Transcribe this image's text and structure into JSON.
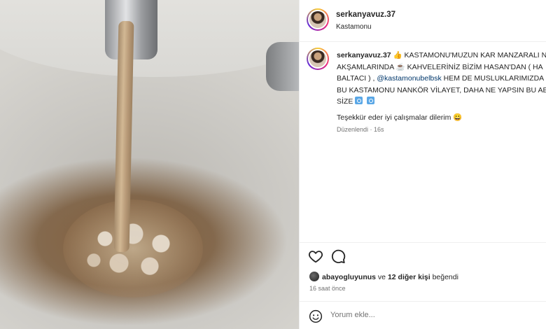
{
  "post": {
    "username": "serkanyavuz.37",
    "location": "Kastamonu"
  },
  "caption": {
    "username": "serkanyavuz.37",
    "line1_a": " 👍 KASTAMONU'MUZUN KAR MANZARALI N",
    "line2_a": "AKŞAMLARINDA ",
    "line2_emoji": "☕",
    "line2_b": " KAHVELERİNİZ BİZİM HASAN'DAN ( HA",
    "line3_a": "BALTACI ) , ",
    "mention": "@kastamonubelbsk",
    "line3_b": " HEM DE MUSLUKLARIMIZDA",
    "line4": "BU KASTAMONU NANKÖR VİLAYET, DAHA NE YAPSIN BU AB",
    "line5": "SİZE",
    "thanks": "Teşekkür eder iyi çalışmalar dilerim 😀",
    "edited": "Düzenlendi",
    "age": "16s"
  },
  "likes": {
    "user": "abayogluyunus",
    "connector": " ve ",
    "others": "12 diğer kişi",
    "suffix": " beğendi"
  },
  "time_ago": "16 saat önce",
  "comment": {
    "placeholder": "Yorum ekle..."
  },
  "icons": [
    "heart-icon",
    "comment-icon",
    "emoji-icon",
    "refresh-emoji-icon"
  ],
  "colors": {
    "mention": "#00376b",
    "muted": "#737373",
    "text": "#262626"
  }
}
